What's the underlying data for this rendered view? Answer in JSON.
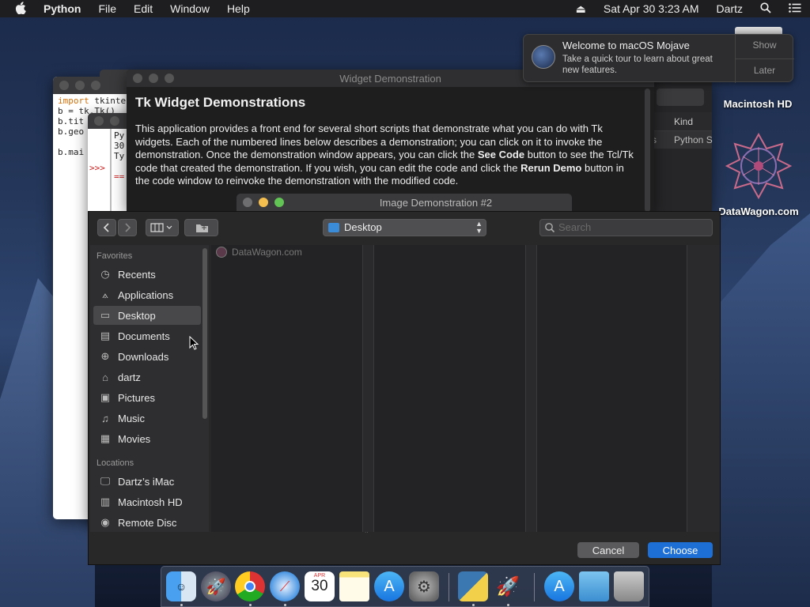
{
  "menubar": {
    "app": "Python",
    "items": [
      "File",
      "Edit",
      "Window",
      "Help"
    ],
    "datetime": "Sat Apr 30  3:23 AM",
    "user": "Dartz"
  },
  "desktop": {
    "icons": [
      {
        "label": "Macintosh HD"
      },
      {
        "label": "DataWagon.com"
      }
    ]
  },
  "notification": {
    "title": "Welcome to macOS Mojave",
    "body": "Take a quick tour to learn about great new features.",
    "show": "Show",
    "later": "Later"
  },
  "editor": {
    "lines": [
      "import tkinter",
      "b = tk.Tk()",
      "b.tit",
      "b.geo",
      "",
      "b.mai"
    ]
  },
  "shell": {
    "lines": [
      "Py",
      "30",
      "Ty"
    ],
    "prompt": ">>>",
    "separator": "=="
  },
  "finder_bg": {
    "kind_header": "Kind",
    "kind_value": "Python S",
    "s_fragment": "s"
  },
  "widget_demo": {
    "title": "Widget Demonstration",
    "heading": "Tk Widget Demonstrations",
    "para_html_parts": [
      "This application provides a front end for several short scripts that demonstrate what you can do with Tk widgets.  Each of the numbered lines below describes a demonstration; you can click on it to invoke the demonstration.  Once the demonstration window appears, you can click the ",
      "See Code",
      " button to see the Tcl/Tk code that created the demonstration.  If you wish, you can edit the code and click the ",
      "Rerun Demo",
      " button in the code window to reinvoke the demonstration with the modified code."
    ]
  },
  "image_demo": {
    "title": "Image Demonstration #2"
  },
  "dialog": {
    "location": "Desktop",
    "search_placeholder": "Search",
    "favorites_label": "Favorites",
    "locations_label": "Locations",
    "favorites": [
      {
        "label": "Recents",
        "icon": "clock-icon"
      },
      {
        "label": "Applications",
        "icon": "applications-icon"
      },
      {
        "label": "Desktop",
        "icon": "desktop-icon"
      },
      {
        "label": "Documents",
        "icon": "documents-icon"
      },
      {
        "label": "Downloads",
        "icon": "downloads-icon"
      },
      {
        "label": "dartz",
        "icon": "home-icon"
      },
      {
        "label": "Pictures",
        "icon": "pictures-icon"
      },
      {
        "label": "Music",
        "icon": "music-icon"
      },
      {
        "label": "Movies",
        "icon": "movies-icon"
      }
    ],
    "locations": [
      {
        "label": "Dartz’s iMac",
        "icon": "imac-icon"
      },
      {
        "label": "Macintosh HD",
        "icon": "disk-icon"
      },
      {
        "label": "Remote Disc",
        "icon": "disc-icon"
      }
    ],
    "files": [
      "DataWagon.com"
    ],
    "cancel": "Cancel",
    "choose": "Choose",
    "accent": "#1d6fd6"
  },
  "dock": {
    "items": [
      "finder",
      "launchpad",
      "chrome",
      "safari",
      "calendar",
      "notes",
      "app-store",
      "system-preferences",
      "python-launcher",
      "idle",
      "app-store-2",
      "folder",
      "trash"
    ],
    "calendar_month": "APR",
    "calendar_day": "30"
  }
}
